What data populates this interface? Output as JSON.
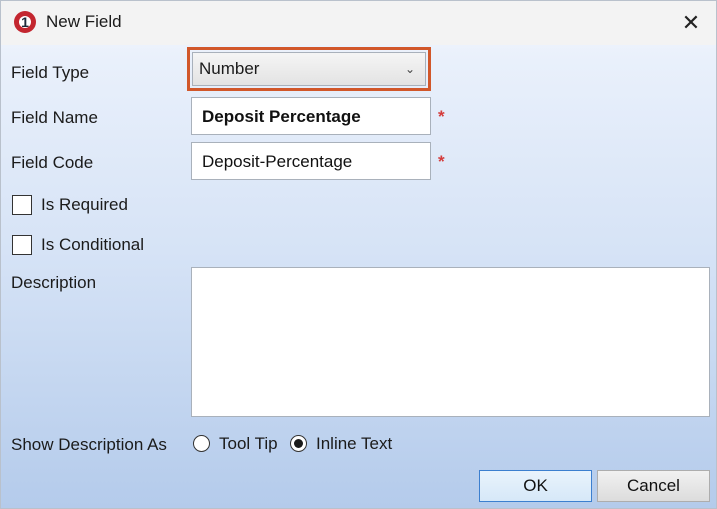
{
  "window": {
    "title": "New Field",
    "close_glyph": "✕",
    "app_icon_glyph": "1"
  },
  "form": {
    "field_type_label": "Field Type",
    "field_type_value": "Number",
    "field_name_label": "Field Name",
    "field_name_value": "Deposit Percentage",
    "field_code_label": "Field Code",
    "field_code_value": "Deposit-Percentage",
    "required_marker": "*",
    "is_required_label": "Is Required",
    "is_required_checked": false,
    "is_conditional_label": "Is Conditional",
    "is_conditional_checked": false,
    "description_label": "Description",
    "description_value": "",
    "show_description_label": "Show Description As",
    "options": [
      {
        "label": "Tool Tip",
        "selected": false
      },
      {
        "label": "Inline Text",
        "selected": true
      }
    ]
  },
  "buttons": {
    "ok": "OK",
    "cancel": "Cancel"
  },
  "colors": {
    "highlight_border": "#d1572a",
    "required_marker": "#d43b3b",
    "app_icon": "#c3262f"
  },
  "icons": {
    "dropdown": "chevron-down-icon",
    "close": "close-icon",
    "app": "app-logo-icon"
  }
}
